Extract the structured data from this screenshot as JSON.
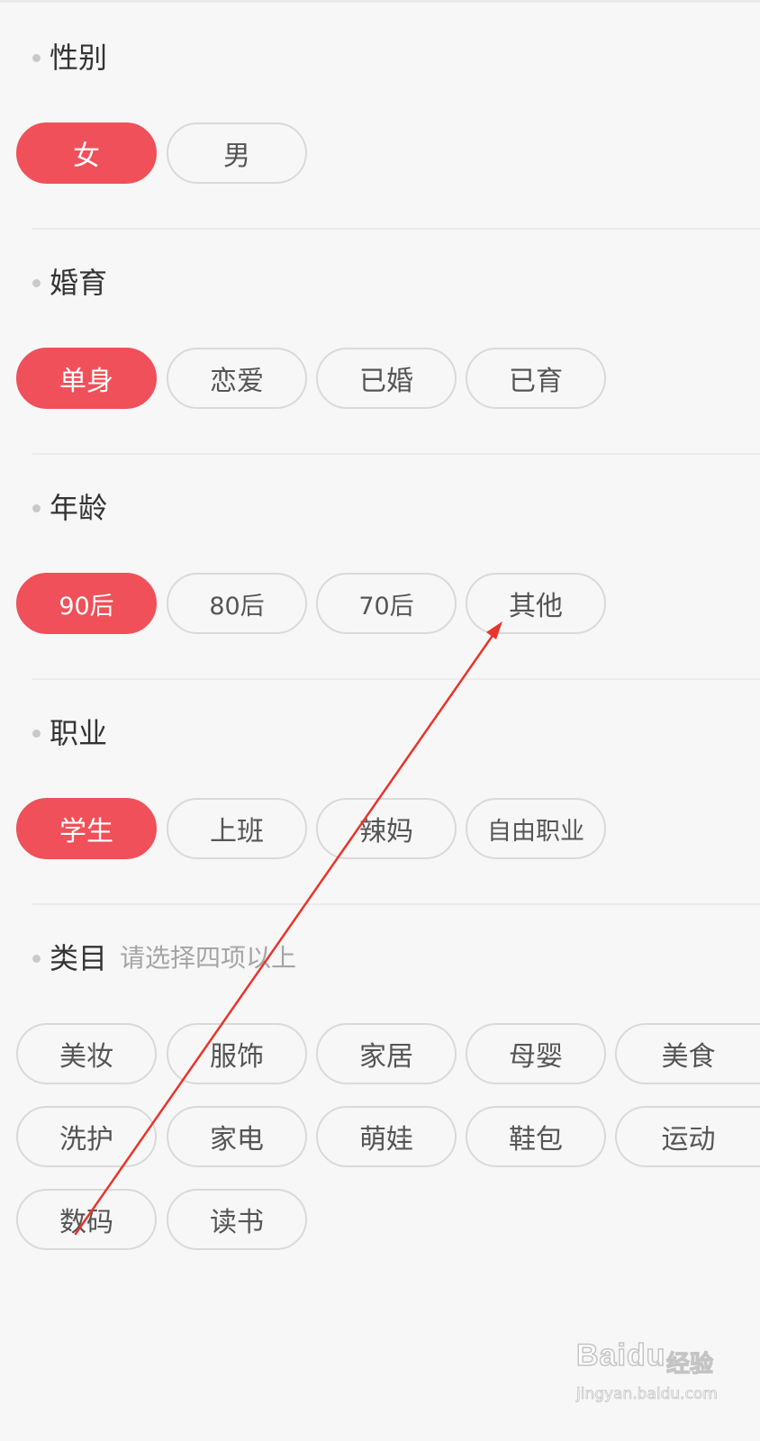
{
  "colors": {
    "accent": "#f05059",
    "background": "#f7f7f7",
    "pill_border": "#d9d9d9",
    "title_text": "#333333",
    "hint_text": "#a5a5a5",
    "annotation_arrow": "#e8342b"
  },
  "sections": {
    "gender": {
      "title": "性别",
      "options": [
        "女",
        "男"
      ],
      "selected": "女"
    },
    "marriage": {
      "title": "婚育",
      "options": [
        "单身",
        "恋爱",
        "已婚",
        "已育"
      ],
      "selected": "单身"
    },
    "age": {
      "title": "年龄",
      "options": [
        "90后",
        "80后",
        "70后",
        "其他"
      ],
      "selected": "90后"
    },
    "occupation": {
      "title": "职业",
      "options": [
        "学生",
        "上班",
        "辣妈",
        "自由职业"
      ],
      "selected": "学生"
    },
    "category": {
      "title": "类目",
      "hint": "请选择四项以上",
      "options": [
        "美妆",
        "服饰",
        "家居",
        "母婴",
        "美食",
        "洗护",
        "家电",
        "萌娃",
        "鞋包",
        "运动",
        "数码",
        "读书"
      ]
    }
  },
  "watermark": {
    "brand": "Baidu",
    "sub": "经验",
    "url": "jingyan.baidu.com"
  }
}
